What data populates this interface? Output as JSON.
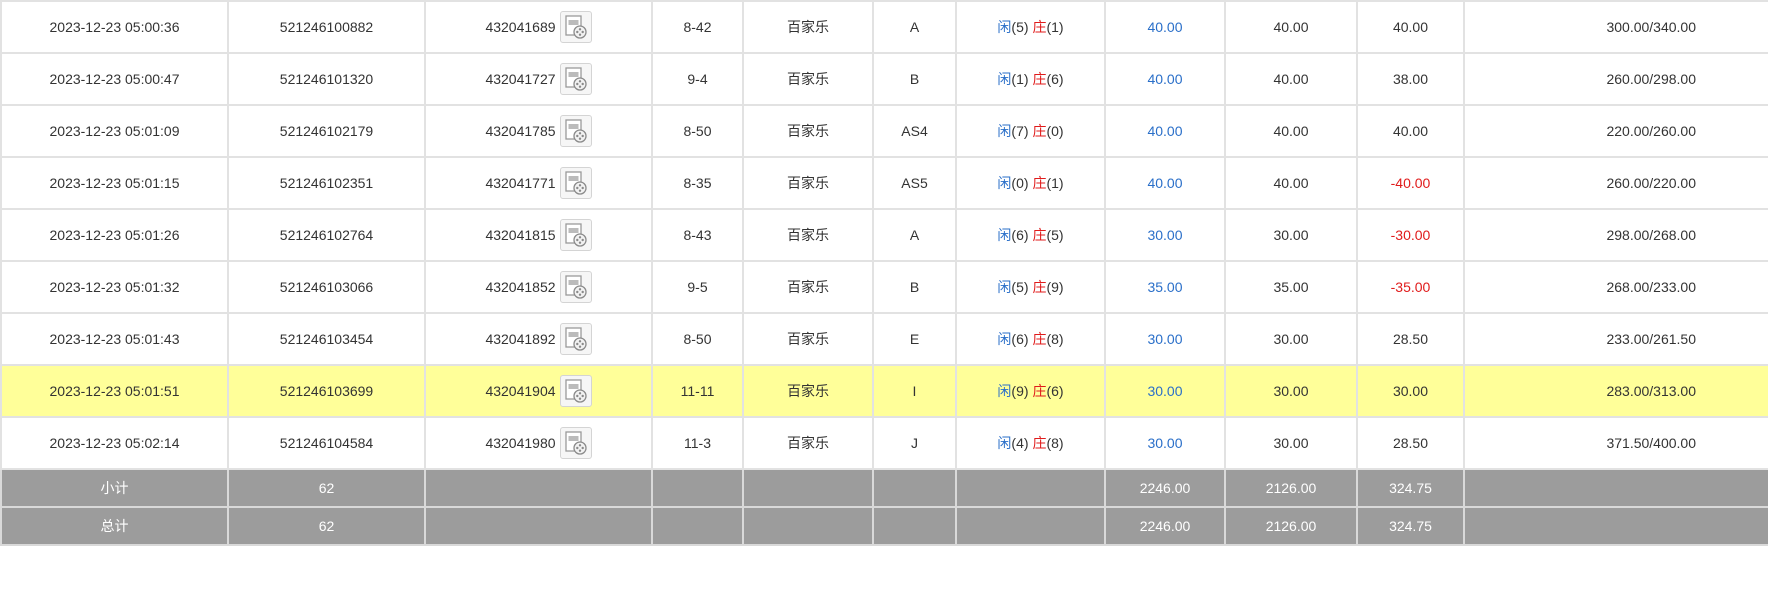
{
  "table": {
    "rows": [
      {
        "time": "2023-12-23 05:00:36",
        "order": "521246100882",
        "round": "432041689",
        "table": "8-42",
        "game": "百家乐",
        "bet": "A",
        "player_label": "闲",
        "player_val": "(5)",
        "banker_label": "庄",
        "banker_val": "(1)",
        "bet_amount": "40.00",
        "valid": "40.00",
        "winloss": "40.00",
        "winloss_neg": false,
        "balance": "300.00/340.00",
        "highlight": false
      },
      {
        "time": "2023-12-23 05:00:47",
        "order": "521246101320",
        "round": "432041727",
        "table": "9-4",
        "game": "百家乐",
        "bet": "B",
        "player_label": "闲",
        "player_val": "(1)",
        "banker_label": "庄",
        "banker_val": "(6)",
        "bet_amount": "40.00",
        "valid": "40.00",
        "winloss": "38.00",
        "winloss_neg": false,
        "balance": "260.00/298.00",
        "highlight": false
      },
      {
        "time": "2023-12-23 05:01:09",
        "order": "521246102179",
        "round": "432041785",
        "table": "8-50",
        "game": "百家乐",
        "bet": "AS4",
        "player_label": "闲",
        "player_val": "(7)",
        "banker_label": "庄",
        "banker_val": "(0)",
        "bet_amount": "40.00",
        "valid": "40.00",
        "winloss": "40.00",
        "winloss_neg": false,
        "balance": "220.00/260.00",
        "highlight": false
      },
      {
        "time": "2023-12-23 05:01:15",
        "order": "521246102351",
        "round": "432041771",
        "table": "8-35",
        "game": "百家乐",
        "bet": "AS5",
        "player_label": "闲",
        "player_val": "(0)",
        "banker_label": "庄",
        "banker_val": "(1)",
        "bet_amount": "40.00",
        "valid": "40.00",
        "winloss": "-40.00",
        "winloss_neg": true,
        "balance": "260.00/220.00",
        "highlight": false
      },
      {
        "time": "2023-12-23 05:01:26",
        "order": "521246102764",
        "round": "432041815",
        "table": "8-43",
        "game": "百家乐",
        "bet": "A",
        "player_label": "闲",
        "player_val": "(6)",
        "banker_label": "庄",
        "banker_val": "(5)",
        "bet_amount": "30.00",
        "valid": "30.00",
        "winloss": "-30.00",
        "winloss_neg": true,
        "balance": "298.00/268.00",
        "highlight": false
      },
      {
        "time": "2023-12-23 05:01:32",
        "order": "521246103066",
        "round": "432041852",
        "table": "9-5",
        "game": "百家乐",
        "bet": "B",
        "player_label": "闲",
        "player_val": "(5)",
        "banker_label": "庄",
        "banker_val": "(9)",
        "bet_amount": "35.00",
        "valid": "35.00",
        "winloss": "-35.00",
        "winloss_neg": true,
        "balance": "268.00/233.00",
        "highlight": false
      },
      {
        "time": "2023-12-23 05:01:43",
        "order": "521246103454",
        "round": "432041892",
        "table": "8-50",
        "game": "百家乐",
        "bet": "E",
        "player_label": "闲",
        "player_val": "(6)",
        "banker_label": "庄",
        "banker_val": "(8)",
        "bet_amount": "30.00",
        "valid": "30.00",
        "winloss": "28.50",
        "winloss_neg": false,
        "balance": "233.00/261.50",
        "highlight": false
      },
      {
        "time": "2023-12-23 05:01:51",
        "order": "521246103699",
        "round": "432041904",
        "table": "11-11",
        "game": "百家乐",
        "bet": "I",
        "player_label": "闲",
        "player_val": "(9)",
        "banker_label": "庄",
        "banker_val": "(6)",
        "bet_amount": "30.00",
        "valid": "30.00",
        "winloss": "30.00",
        "winloss_neg": false,
        "balance": "283.00/313.00",
        "highlight": true
      },
      {
        "time": "2023-12-23 05:02:14",
        "order": "521246104584",
        "round": "432041980",
        "table": "11-3",
        "game": "百家乐",
        "bet": "J",
        "player_label": "闲",
        "player_val": "(4)",
        "banker_label": "庄",
        "banker_val": "(8)",
        "bet_amount": "30.00",
        "valid": "30.00",
        "winloss": "28.50",
        "winloss_neg": false,
        "balance": "371.50/400.00",
        "highlight": false
      }
    ],
    "subtotal": {
      "label": "小计",
      "count": "62",
      "bet_amount": "2246.00",
      "valid": "2126.00",
      "winloss": "324.75"
    },
    "total": {
      "label": "总计",
      "count": "62",
      "bet_amount": "2246.00",
      "valid": "2126.00",
      "winloss": "324.75"
    }
  },
  "icons": {
    "replay": "video-replay-icon"
  },
  "colors": {
    "highlight": "#ffff99",
    "footer": "#9c9c9c",
    "blue": "#2a6fc9",
    "red": "#e01b1b"
  }
}
